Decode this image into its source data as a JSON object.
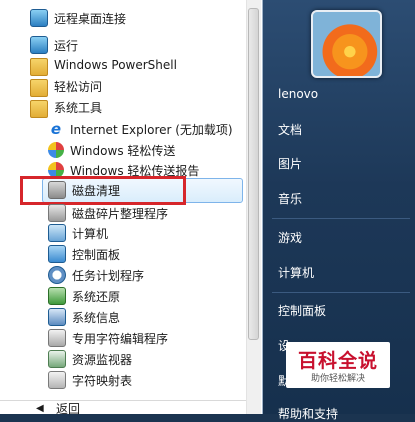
{
  "programs": {
    "items": [
      {
        "label": "远程桌面连接",
        "icon": "remote-desktop-icon"
      },
      {
        "label": "运行",
        "icon": "run-icon"
      },
      {
        "label": "Windows PowerShell",
        "icon": "folder-icon"
      },
      {
        "label": "轻松访问",
        "icon": "folder-icon"
      },
      {
        "label": "系统工具",
        "icon": "folder-icon"
      }
    ],
    "system_tools": [
      {
        "label": "Internet Explorer (无加载项)",
        "icon": "internet-explorer-icon"
      },
      {
        "label": "Windows 轻松传送",
        "icon": "windows-logo-icon"
      },
      {
        "label": "Windows 轻松传送报告",
        "icon": "windows-logo-icon"
      },
      {
        "label": "磁盘清理",
        "icon": "disk-cleanup-icon"
      },
      {
        "label": "磁盘碎片整理程序",
        "icon": "defrag-icon"
      },
      {
        "label": "计算机",
        "icon": "computer-icon"
      },
      {
        "label": "控制面板",
        "icon": "control-panel-icon"
      },
      {
        "label": "任务计划程序",
        "icon": "task-scheduler-icon"
      },
      {
        "label": "系统还原",
        "icon": "system-restore-icon"
      },
      {
        "label": "系统信息",
        "icon": "system-info-icon"
      },
      {
        "label": "专用字符编辑程序",
        "icon": "char-editor-icon"
      },
      {
        "label": "资源监视器",
        "icon": "resource-monitor-icon"
      },
      {
        "label": "字符映射表",
        "icon": "char-map-icon"
      }
    ],
    "back_label": "返回"
  },
  "right": {
    "user": "lenovo",
    "links": [
      "文档",
      "图片",
      "音乐",
      "游戏",
      "计算机",
      "控制面板",
      "设",
      "默",
      "帮助和支持"
    ]
  },
  "watermark": {
    "title": "百科全说",
    "subtitle": "助你轻松解决"
  },
  "colors": {
    "highlight_border": "#d6262b",
    "right_pane": "#1d3858"
  }
}
